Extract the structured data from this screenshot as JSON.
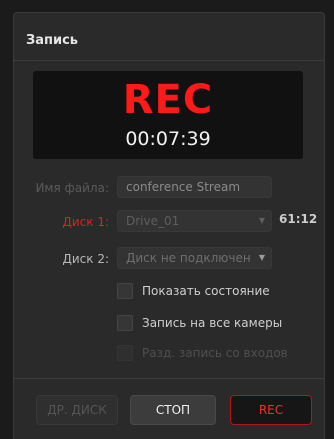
{
  "panel": {
    "title": "Запись"
  },
  "display": {
    "rec_label": "REC",
    "timecode": "00:07:39"
  },
  "form": {
    "filename_label": "Имя файла:",
    "filename_value": "conference Stream",
    "disk1_label": "Диск 1:",
    "disk1_value": "Drive_01",
    "disk1_remaining": "61:12",
    "disk2_label": "Диск 2:",
    "disk2_value": "Диск не подключен"
  },
  "options": [
    {
      "label": "Показать состояние",
      "checked": false,
      "enabled": true
    },
    {
      "label": "Запись на все камеры",
      "checked": false,
      "enabled": true
    },
    {
      "label": "Разд. запись со входов",
      "checked": false,
      "enabled": false
    }
  ],
  "buttons": {
    "ext_disk": "ДР. ДИСК",
    "stop": "СТОП",
    "rec": "REC"
  },
  "colors": {
    "accent_red": "#ff1a1a",
    "panel_bg": "#2a2a2a",
    "display_bg": "#111111"
  },
  "icons": {
    "dropdown": "chevron-down-icon"
  }
}
